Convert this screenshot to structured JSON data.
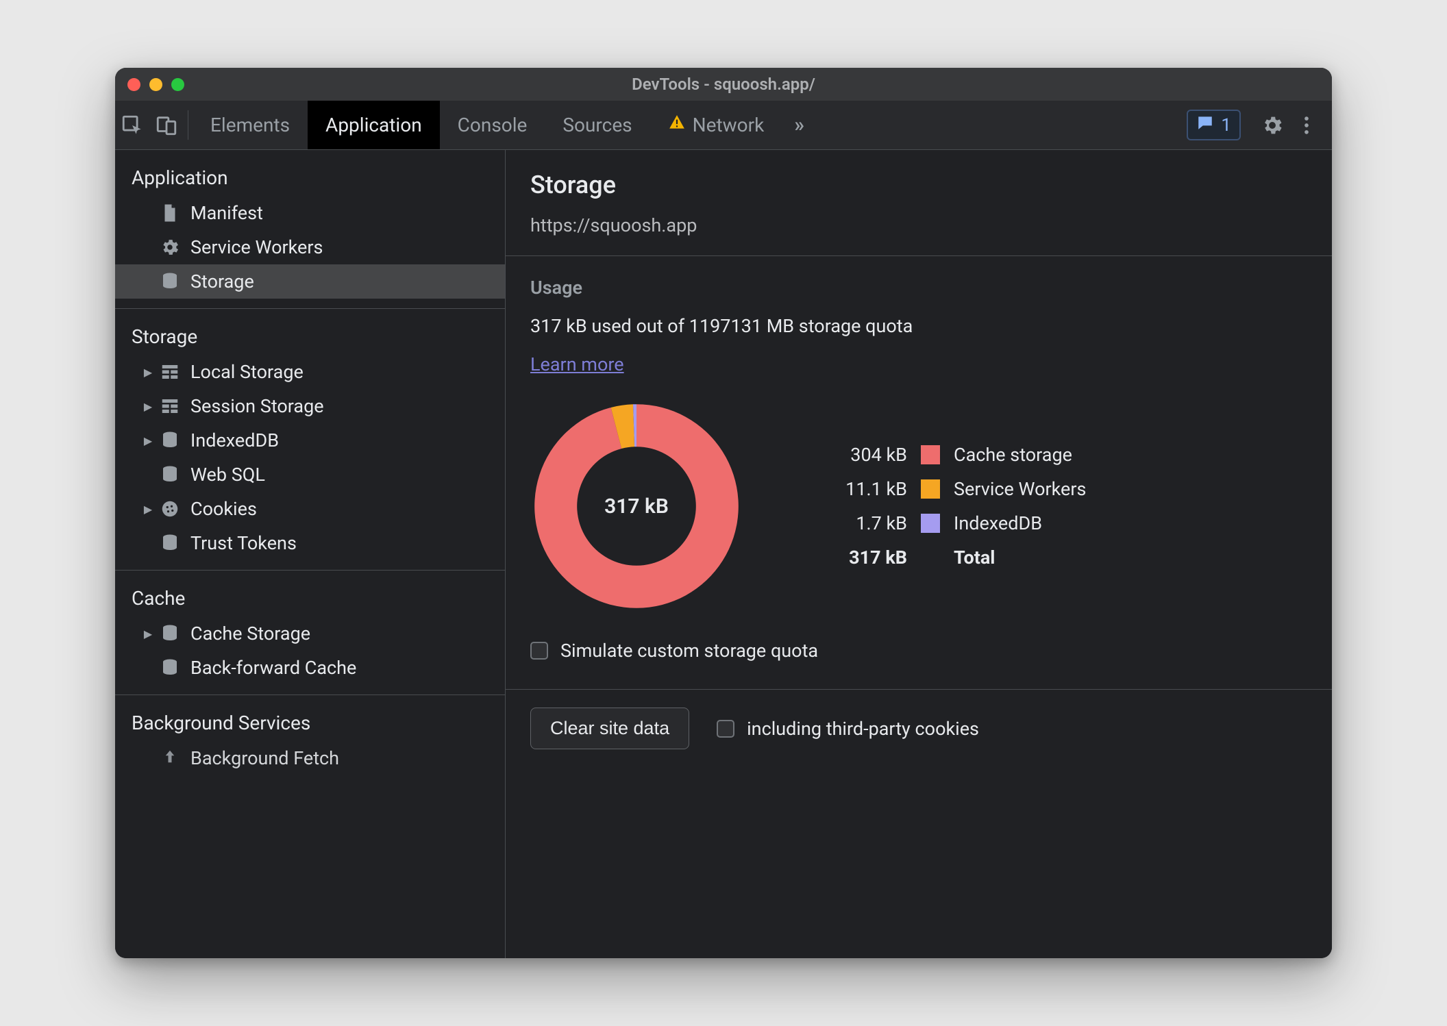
{
  "window": {
    "title": "DevTools - squoosh.app/"
  },
  "tabs": {
    "elements": "Elements",
    "application": "Application",
    "console": "Console",
    "sources": "Sources",
    "network": "Network"
  },
  "issues": {
    "count": "1"
  },
  "sidebar": {
    "groups": {
      "application": {
        "title": "Application",
        "items": {
          "manifest": "Manifest",
          "service_workers": "Service Workers",
          "storage": "Storage"
        }
      },
      "storage": {
        "title": "Storage",
        "items": {
          "local_storage": "Local Storage",
          "session_storage": "Session Storage",
          "indexeddb": "IndexedDB",
          "web_sql": "Web SQL",
          "cookies": "Cookies",
          "trust_tokens": "Trust Tokens"
        }
      },
      "cache": {
        "title": "Cache",
        "items": {
          "cache_storage": "Cache Storage",
          "bf_cache": "Back-forward Cache"
        }
      },
      "background": {
        "title": "Background Services",
        "items": {
          "background_fetch": "Background Fetch"
        }
      }
    }
  },
  "main": {
    "heading": "Storage",
    "origin": "https://squoosh.app",
    "usage_title": "Usage",
    "usage_line": "317 kB used out of 1197131 MB storage quota",
    "learn_more": "Learn more",
    "donut_center": "317 kB",
    "legend": {
      "cache_size": "304 kB",
      "cache_label": "Cache storage",
      "sw_size": "11.1 kB",
      "sw_label": "Service Workers",
      "idb_size": "1.7 kB",
      "idb_label": "IndexedDB",
      "total_size": "317 kB",
      "total_label": "Total"
    },
    "simulate_label": "Simulate custom storage quota",
    "clear_button": "Clear site data",
    "third_party_label": "including third-party cookies"
  },
  "colors": {
    "cache": "#ee6d6d",
    "sw": "#f5a623",
    "idb": "#a59cf0"
  },
  "chart_data": {
    "type": "pie",
    "title": "Storage usage breakdown",
    "series": [
      {
        "name": "Cache storage",
        "value_kb": 304,
        "color": "#ee6d6d"
      },
      {
        "name": "Service Workers",
        "value_kb": 11.1,
        "color": "#f5a623"
      },
      {
        "name": "IndexedDB",
        "value_kb": 1.7,
        "color": "#a59cf0"
      }
    ],
    "total_kb": 317,
    "center_label": "317 kB"
  }
}
